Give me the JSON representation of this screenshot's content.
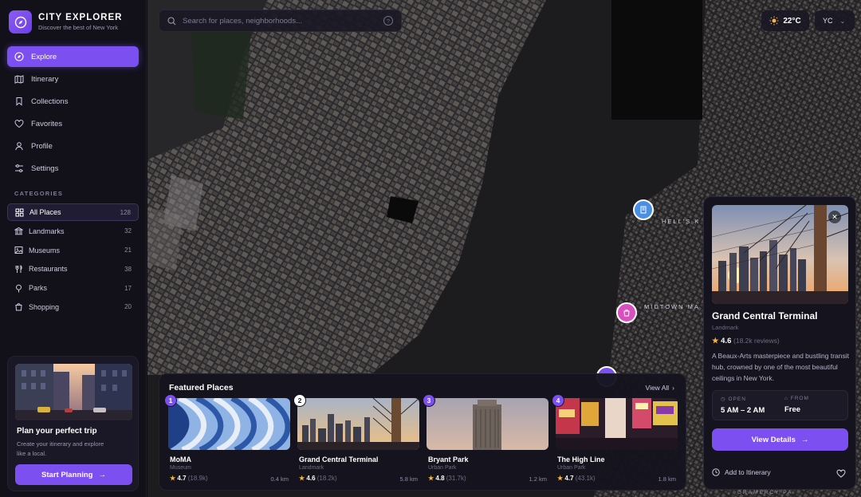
{
  "brand": {
    "title": "CITY EXPLORER",
    "subtitle": "Discover the best of New York"
  },
  "nav": [
    {
      "label": "Explore",
      "icon": "compass-icon",
      "active": true
    },
    {
      "label": "Itinerary",
      "icon": "map-icon"
    },
    {
      "label": "Collections",
      "icon": "bookmark-icon"
    },
    {
      "label": "Favorites",
      "icon": "heart-icon"
    },
    {
      "label": "Profile",
      "icon": "user-icon"
    },
    {
      "label": "Settings",
      "icon": "sliders-icon"
    }
  ],
  "categories": {
    "heading": "CATEGORIES",
    "items": [
      {
        "label": "All Places",
        "count": "128",
        "icon": "grid-icon",
        "active": true
      },
      {
        "label": "Landmarks",
        "count": "32",
        "icon": "landmark-icon"
      },
      {
        "label": "Museums",
        "count": "21",
        "icon": "image-icon"
      },
      {
        "label": "Restaurants",
        "count": "38",
        "icon": "utensils-icon"
      },
      {
        "label": "Parks",
        "count": "17",
        "icon": "tree-icon"
      },
      {
        "label": "Shopping",
        "count": "20",
        "icon": "shopping-bag-icon"
      }
    ]
  },
  "plan": {
    "title": "Plan your perfect trip",
    "desc": "Create your itinerary and explore like a local.",
    "button": "Start Planning"
  },
  "search": {
    "placeholder": "Search for places, neighborhoods..."
  },
  "weather": {
    "temp": "22°C"
  },
  "user": {
    "initials": "YC"
  },
  "map_labels": [
    "HELL'S K",
    "MIDTOWN MA",
    "GRAMERCY PA"
  ],
  "featured": {
    "title": "Featured Places",
    "view_all": "View All",
    "places": [
      {
        "num": "1",
        "name": "MoMA",
        "category": "Museum",
        "rating": "4.7",
        "reviews": "(18.9k)",
        "distance": "0.4 km"
      },
      {
        "num": "2",
        "name": "Grand Central Terminal",
        "category": "Landmark",
        "rating": "4.6",
        "reviews": "(18.2k)",
        "distance": "5.8 km"
      },
      {
        "num": "3",
        "name": "Bryant Park",
        "category": "Urban Park",
        "rating": "4.8",
        "reviews": "(31.7k)",
        "distance": "1.2 km"
      },
      {
        "num": "4",
        "name": "The High Line",
        "category": "Urban Park",
        "rating": "4.7",
        "reviews": "(43.1k)",
        "distance": "1.8 km"
      }
    ]
  },
  "detail": {
    "title": "Grand Central Terminal",
    "category": "Landmark",
    "rating": "4.6",
    "reviews": "(18.2k reviews)",
    "description": "A Beaux-Arts masterpiece and bustling transit hub, crowned by one of the most beautiful ceilings in New York.",
    "open_label": "OPEN",
    "open_value": "5 AM – 2 AM",
    "from_label": "FROM",
    "from_value": "Free",
    "button": "View Details",
    "add_itinerary": "Add to Itinerary"
  },
  "colors": {
    "accent": "#7c4ff0",
    "pin_blue": "#4a90e2",
    "pin_pink": "#d94fc0"
  }
}
